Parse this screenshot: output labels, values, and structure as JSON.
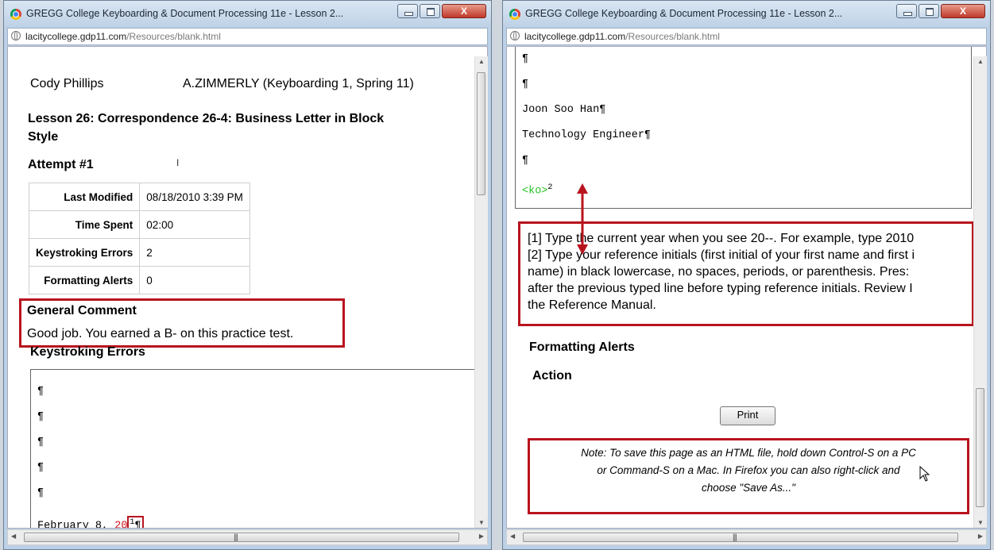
{
  "window_title": "GREGG College Keyboarding & Document Processing 11e - Lesson 2...",
  "window_controls": {
    "close": "X"
  },
  "url": {
    "host": "lacitycollege.gdp11.com",
    "path": "/Resources/blank.html"
  },
  "left": {
    "student_name": "Cody Phillips",
    "instructor": "A.ZIMMERLY (Keyboarding 1, Spring 11)",
    "lesson_title_line1": "Lesson 26: Correspondence 26-4: Business Letter in Block",
    "lesson_title_line2": "Style",
    "attempt": "Attempt #1",
    "meta": [
      {
        "label": "Last Modified",
        "value": "08/18/2010 3:39 PM"
      },
      {
        "label": "Time Spent",
        "value": "02:00"
      },
      {
        "label": "Keystroking Errors",
        "value": "2"
      },
      {
        "label": "Formatting Alerts",
        "value": "0"
      }
    ],
    "general_comment_heading": "General Comment",
    "general_comment_text": "Good job. You earned a B- on this practice test.",
    "keystroking_heading": "Keystroking Errors",
    "doc_lines": [
      "¶",
      "¶",
      "¶",
      "¶",
      "¶"
    ],
    "date_line": {
      "text": "February 8, ",
      "error": "20",
      "marker": "1",
      "pilcrow": "¶"
    }
  },
  "right": {
    "doc_lines": [
      "¶",
      "¶",
      "Joon Soo Han¶",
      "Technology Engineer¶",
      "¶"
    ],
    "ko": {
      "text": "<ko>",
      "marker": "2"
    },
    "footnotes": [
      "[1] Type the current year when you see 20--. For example, type 2010",
      "[2] Type your reference initials (first initial of your first name and first i",
      "name) in black lowercase, no spaces, periods, or parenthesis. Pres:",
      "after the previous typed line before typing reference initials. Review I",
      "the Reference Manual."
    ],
    "formatting_alerts_heading": "Formatting Alerts",
    "action_heading": "Action",
    "print_label": "Print",
    "note_lines": [
      "Note: To save this page as an HTML file, hold down Control-S on a PC",
      "or Command-S on a Mac. In Firefox you can also right-click and",
      "choose \"Save As...\""
    ]
  },
  "colors": {
    "error_red": "#d0101a",
    "box_red": "#b8141e",
    "ko_green": "#22c322"
  }
}
